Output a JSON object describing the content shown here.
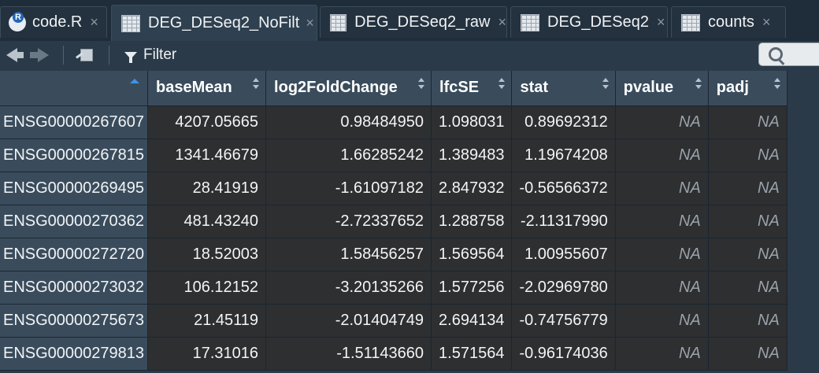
{
  "tabs": [
    {
      "label": "code.R",
      "icon": "r-script-icon",
      "active": false
    },
    {
      "label": "DEG_DESeq2_NoFilt",
      "icon": "data-grid-icon",
      "active": true
    },
    {
      "label": "DEG_DESeq2_raw",
      "icon": "data-grid-icon",
      "active": false
    },
    {
      "label": "DEG_DESeq2",
      "icon": "data-grid-icon",
      "active": false
    },
    {
      "label": "counts",
      "icon": "data-grid-icon",
      "active": false
    }
  ],
  "tab_close_glyph": "×",
  "toolbar": {
    "filter_label": "Filter"
  },
  "table": {
    "columns": [
      "",
      "baseMean",
      "log2FoldChange",
      "lfcSE",
      "stat",
      "pvalue",
      "padj"
    ],
    "rows": [
      [
        "ENSG00000267607",
        "4207.05665",
        "0.98484950",
        "1.098031",
        "0.89692312",
        "NA",
        "NA"
      ],
      [
        "ENSG00000267815",
        "1341.46679",
        "1.66285242",
        "1.389483",
        "1.19674208",
        "NA",
        "NA"
      ],
      [
        "ENSG00000269495",
        "28.41919",
        "-1.61097182",
        "2.847932",
        "-0.56566372",
        "NA",
        "NA"
      ],
      [
        "ENSG00000270362",
        "481.43240",
        "-2.72337652",
        "1.288758",
        "-2.11317990",
        "NA",
        "NA"
      ],
      [
        "ENSG00000272720",
        "18.52003",
        "1.58456257",
        "1.569564",
        "1.00955607",
        "NA",
        "NA"
      ],
      [
        "ENSG00000273032",
        "106.12152",
        "-3.20135266",
        "1.577256",
        "-2.02969780",
        "NA",
        "NA"
      ],
      [
        "ENSG00000275673",
        "21.45119",
        "-2.01404749",
        "2.694134",
        "-0.74756779",
        "NA",
        "NA"
      ],
      [
        "ENSG00000279813",
        "17.31016",
        "-1.51143660",
        "1.571564",
        "-0.96174036",
        "NA",
        "NA"
      ]
    ]
  },
  "colors": {
    "accent": "#3d94e8",
    "header_bg": "#3a4c5c",
    "cell_bg": "#2d2f31",
    "na_text": "#9aa2a9"
  }
}
